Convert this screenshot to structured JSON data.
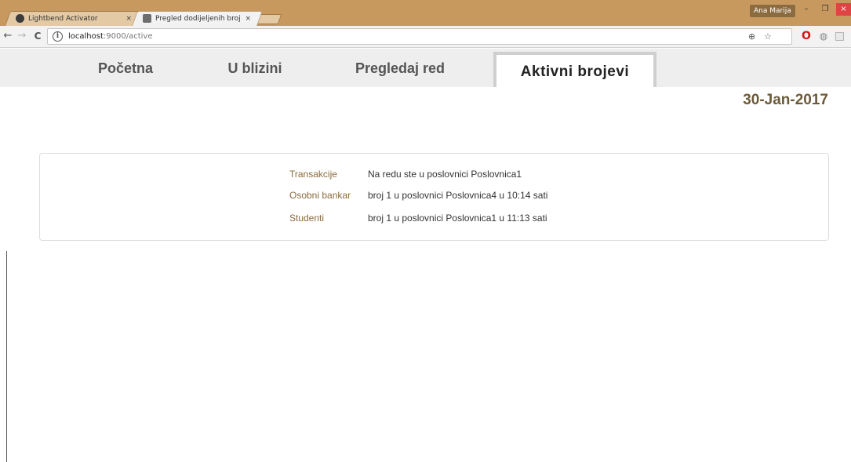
{
  "browser": {
    "tabs": [
      {
        "title": "Lightbend Activator",
        "close": "×",
        "favicon_color": "#3b3b3b"
      },
      {
        "title": "Pregled dodijeljenih broj",
        "close": "×",
        "favicon_color": "#6d6d6d"
      }
    ],
    "profile_name": "Ana Marija",
    "window_buttons": {
      "minimize": "–",
      "maximize": "❐",
      "close": "×"
    },
    "nav": {
      "back": "←",
      "forward": "→",
      "reload": "C"
    },
    "address": {
      "host": "localhost",
      "path": ":9000/active"
    },
    "omnibox_icons": {
      "info": "i",
      "zoom": "⊕",
      "star": "☆"
    },
    "extensions": {
      "opera": "O",
      "circle": "◍"
    }
  },
  "nav": {
    "items": [
      {
        "label": "Početna"
      },
      {
        "label": "U blizini"
      },
      {
        "label": "Pregledaj red"
      },
      {
        "label": "Aktivni brojevi"
      }
    ]
  },
  "date": "30-Jan-2017",
  "rows": [
    {
      "label": "Transakcije",
      "value": "Na redu ste u poslovnici Poslovnica1"
    },
    {
      "label": "Osobni bankar",
      "value": "broj 1 u poslovnici Poslovnica4 u 10:14 sati"
    },
    {
      "label": "Studenti",
      "value": "broj 1 u poslovnici Poslovnica1 u 11:13 sati"
    }
  ],
  "colors": {
    "chrome_frame": "#c8995f",
    "label": "#8b6a3e",
    "date": "#6b5a3a",
    "nav_bg": "#eeeeee"
  }
}
